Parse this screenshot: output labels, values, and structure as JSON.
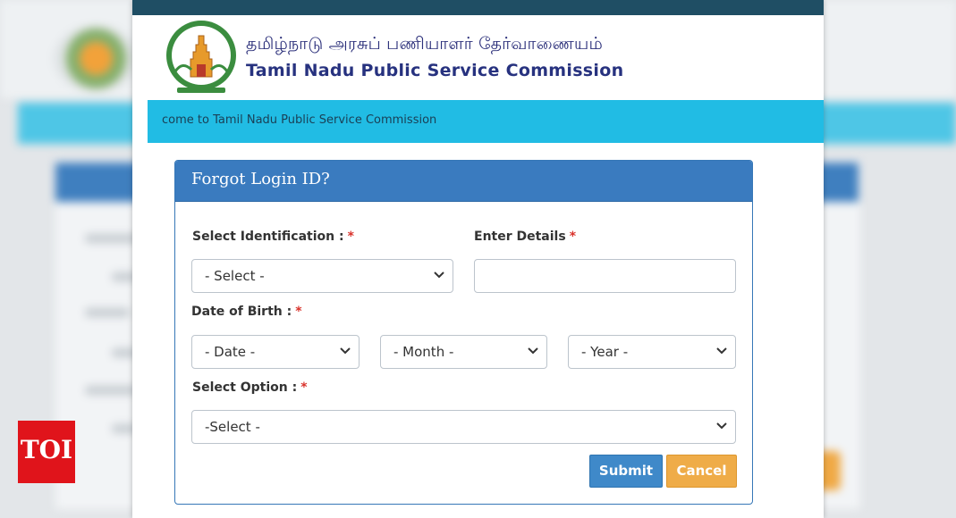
{
  "header": {
    "title_tamil": "தமிழ்நாடு அரசுப் பணியாளர் தேர்வாணையம்",
    "title_english": "Tamil Nadu Public Service Commission",
    "logo_icon": "tnpsc-emblem-icon"
  },
  "marquee": {
    "text": "come to Tamil Nadu Public Service Commission"
  },
  "form": {
    "title": "Forgot Login ID?",
    "identification_label": "Select Identification :",
    "identification_value": "- Select -",
    "details_label": "Enter Details",
    "details_value": "",
    "dob_label": "Date of Birth :",
    "date_value": "- Date -",
    "month_value": "- Month -",
    "year_value": "- Year -",
    "option_label": "Select Option :",
    "option_value": "-Select -",
    "required_mark": "*",
    "submit_label": "Submit",
    "cancel_label": "Cancel"
  },
  "watermark": {
    "text": "TOI"
  },
  "colors": {
    "topbar": "#1f4e64",
    "marquee": "#21bce4",
    "panel_header": "#3a7bbf",
    "submit": "#3f89c9",
    "cancel": "#efac48",
    "required": "#d9322b",
    "toi_red": "#e0141b"
  }
}
